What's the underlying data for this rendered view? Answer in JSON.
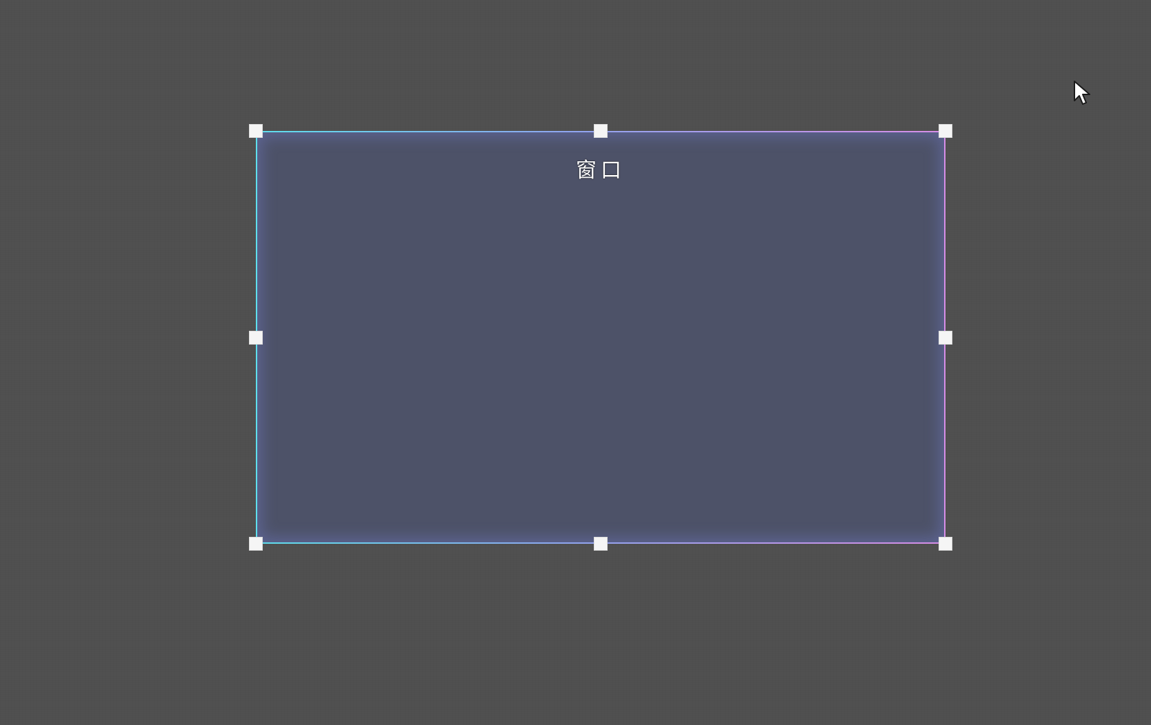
{
  "window": {
    "title": "窗口"
  },
  "colors": {
    "background": "#4f4f4f",
    "window_fill": "#4d5268",
    "border_gradient_start": "#5ee0ee",
    "border_gradient_mid": "#8fa6f0",
    "border_gradient_end": "#d88ee8",
    "handle": "#f5f5f5"
  },
  "icons": {
    "cursor": "arrow-pointer-icon",
    "handles": [
      "resize-handle-top-left",
      "resize-handle-top",
      "resize-handle-top-right",
      "resize-handle-left",
      "resize-handle-right",
      "resize-handle-bottom-left",
      "resize-handle-bottom",
      "resize-handle-bottom-right"
    ]
  }
}
